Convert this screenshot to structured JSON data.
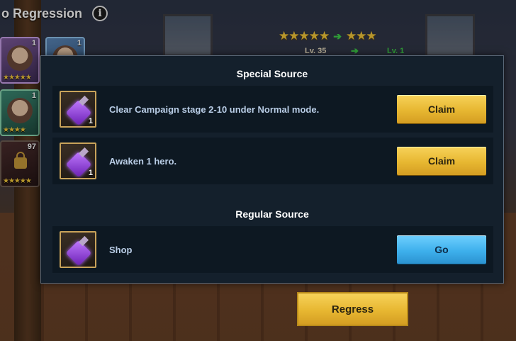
{
  "header": {
    "title": "o Regression",
    "info_icon": "i"
  },
  "hero_cards": [
    {
      "level": "1",
      "stars": "★★★★★",
      "variant": "purple"
    },
    {
      "level": "1",
      "stars": "★★★★",
      "variant": "green"
    },
    {
      "level": "97",
      "stars": "★★★★★",
      "variant": "dark",
      "locked": true
    },
    {
      "level": "1",
      "stars": "",
      "variant": "blue"
    }
  ],
  "upgrade": {
    "stars_from": "★★★★★",
    "stars_to": "★★★",
    "arrow": "➔",
    "level_from": "Lv. 35",
    "level_to": "Lv. 1"
  },
  "modal": {
    "special_title": "Special Source",
    "regular_title": "Regular Source",
    "special_sources": [
      {
        "text": "Clear Campaign stage 2-10 under Normal mode.",
        "count": "1",
        "button": "Claim"
      },
      {
        "text": "Awaken 1 hero.",
        "count": "1",
        "button": "Claim"
      }
    ],
    "regular_sources": [
      {
        "text": "Shop",
        "button": "Go"
      }
    ]
  },
  "footer": {
    "regress_label": "Regress"
  },
  "colors": {
    "gold_button": "#e7b731",
    "blue_button": "#3eb0ec",
    "modal_bg": "#14202c",
    "task_text": "#b9cde6"
  }
}
